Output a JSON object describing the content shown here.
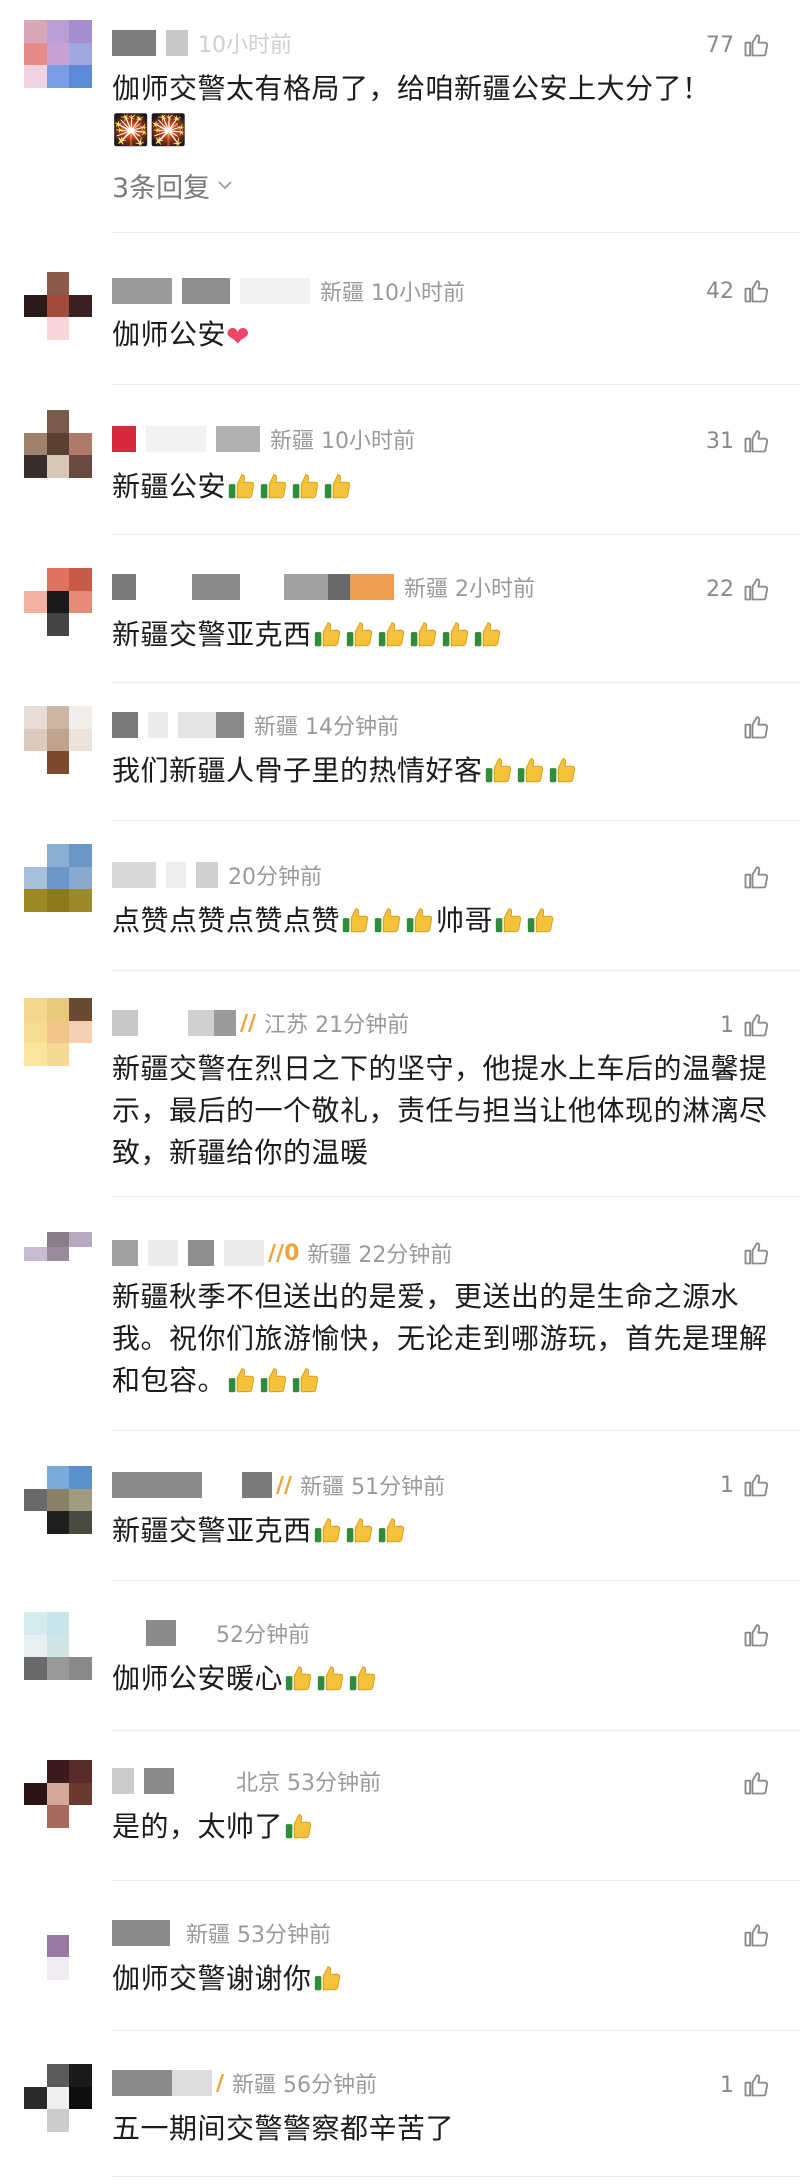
{
  "comments": [
    {
      "meta": "10小时前",
      "likes": "77",
      "text": "伽师交警太有格局了，给咱新疆公安上大分了！",
      "emoji_line": "🎇🎇",
      "replies": "3条回复"
    },
    {
      "meta": "新疆 10小时前",
      "likes": "42",
      "text": "伽师公安"
    },
    {
      "meta": "新疆 10小时前",
      "likes": "31",
      "text": "新疆公安"
    },
    {
      "meta": "新疆 2小时前",
      "likes": "22",
      "text": "新疆交警亚克西"
    },
    {
      "meta": "新疆 14分钟前",
      "likes": "",
      "text": "我们新疆人骨子里的热情好客"
    },
    {
      "meta": "20分钟前",
      "likes": "",
      "text_a": "点赞点赞点赞点赞",
      "text_b": "帅哥"
    },
    {
      "meta": "江苏 21分钟前",
      "likes": "1",
      "text": "新疆交警在烈日之下的坚守，他提水上车后的温馨提示，最后的一个敬礼，责任与担当让他体现的淋漓尽致，新疆给你的温暖"
    },
    {
      "meta": "新疆 22分钟前",
      "likes": "",
      "text": "新疆秋季不但送出的是爱，更送出的是生命之源水我。祝你们旅游愉快，无论走到哪游玩，首先是理解和包容。"
    },
    {
      "meta": "新疆 51分钟前",
      "likes": "1",
      "text": "新疆交警亚克西"
    },
    {
      "meta": "52分钟前",
      "likes": "",
      "text": "伽师公安暖心"
    },
    {
      "meta": "北京 53分钟前",
      "likes": "",
      "text": "是的，太帅了"
    },
    {
      "meta": "新疆 53分钟前",
      "likes": "",
      "text": "伽师交警谢谢你"
    },
    {
      "meta": "新疆 56分钟前",
      "likes": "1",
      "text": "五一期间交警警察都辛苦了"
    }
  ],
  "icons": {
    "like": "thumbs-up-outline-icon",
    "thumb_emoji": "thumbs-up-emoji",
    "heart": "heart-emoji",
    "chevron": "chevron-down-icon"
  },
  "colors": {
    "meta_gray": "#9a9a9a",
    "vip_orange": "#f0a33a",
    "divider": "#ededed"
  }
}
